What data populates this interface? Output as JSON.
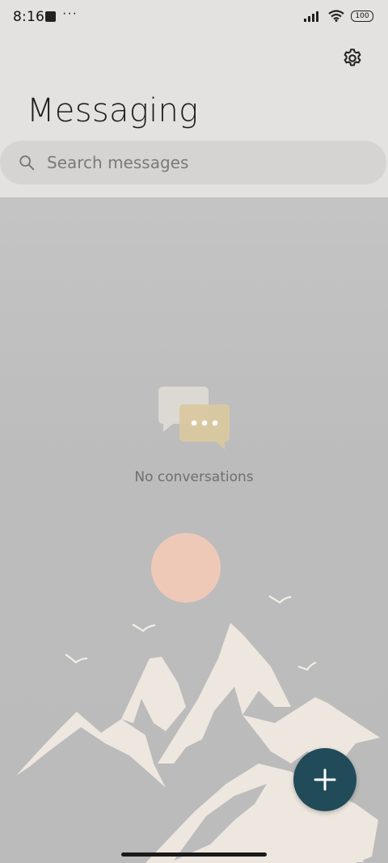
{
  "status_bar": {
    "time": "8:16",
    "notification_dots": "···",
    "battery": "100",
    "icons": [
      "signal-icon",
      "wifi-icon",
      "battery-icon"
    ]
  },
  "header": {
    "title": "Messaging",
    "settings_icon": "gear-icon"
  },
  "search": {
    "placeholder": "Search messages",
    "icon": "search-icon"
  },
  "empty_state": {
    "icon": "chat-bubbles-icon",
    "text": "No conversations"
  },
  "fab": {
    "icon": "plus-icon",
    "color": "#214b59"
  },
  "colors": {
    "header_bg": "#e4e2e0",
    "content_bg": "#bcbcbc",
    "sun": "#efc9b8",
    "mountain": "#ede7df"
  }
}
